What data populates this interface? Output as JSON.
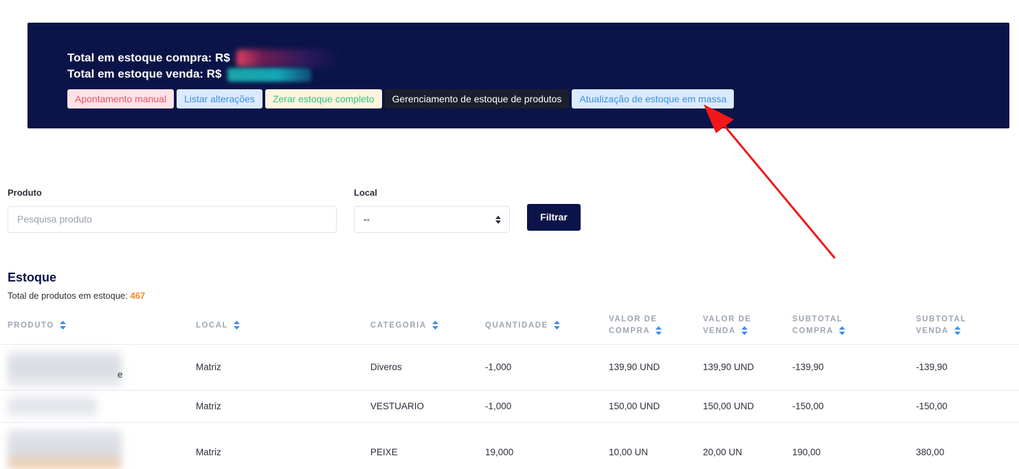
{
  "banner": {
    "compra_label": "Total em estoque compra: R$",
    "venda_label": "Total em estoque venda: R$",
    "buttons": [
      "Apontamento manual",
      "Listar alterações",
      "Zerar estoque completo",
      "Gerenciamento de estoque de produtos",
      "Atualização de estoque em massa"
    ]
  },
  "filters": {
    "produto_label": "Produto",
    "produto_placeholder": "Pesquisa produto",
    "local_label": "Local",
    "local_value": "--",
    "filter_button": "Filtrar"
  },
  "stock": {
    "title": "Estoque",
    "total_label": "Total de produtos em estoque:",
    "total_value": "467"
  },
  "table": {
    "headers": {
      "produto": "PRODUTO",
      "local": "LOCAL",
      "categoria": "CATEGORIA",
      "quantidade": "QUANTIDADE",
      "valor_compra_1": "VALOR DE",
      "valor_compra_2": "COMPRA",
      "valor_venda_1": "VALOR DE",
      "valor_venda_2": "VENDA",
      "subtotal_compra_1": "SUBTOTAL",
      "subtotal_compra_2": "COMPRA",
      "subtotal_venda_1": "SUBTOTAL",
      "subtotal_venda_2": "VENDA"
    },
    "rows": [
      {
        "produto_suffix": "e",
        "local": "Matriz",
        "categoria": "Diveros",
        "quantidade": "-1,000",
        "valor_compra": "139,90 UND",
        "valor_venda": "139,90 UND",
        "subtotal_compra": "-139,90",
        "subtotal_venda": "-139,90"
      },
      {
        "local": "Matriz",
        "categoria": "VESTUARIO",
        "quantidade": "-1,000",
        "valor_compra": "150,00 UND",
        "valor_venda": "150,00 UND",
        "subtotal_compra": "-150,00",
        "subtotal_venda": "-150,00"
      },
      {
        "local": "Matriz",
        "categoria": "PEIXE",
        "quantidade": "19,000",
        "valor_compra": "10,00 UN",
        "valor_venda": "20,00 UN",
        "subtotal_compra": "190,00",
        "subtotal_venda": "380,00"
      }
    ]
  },
  "colors": {
    "navy": "#0b1448",
    "accent_orange": "#f08a24",
    "arrow_red": "#f01818"
  }
}
